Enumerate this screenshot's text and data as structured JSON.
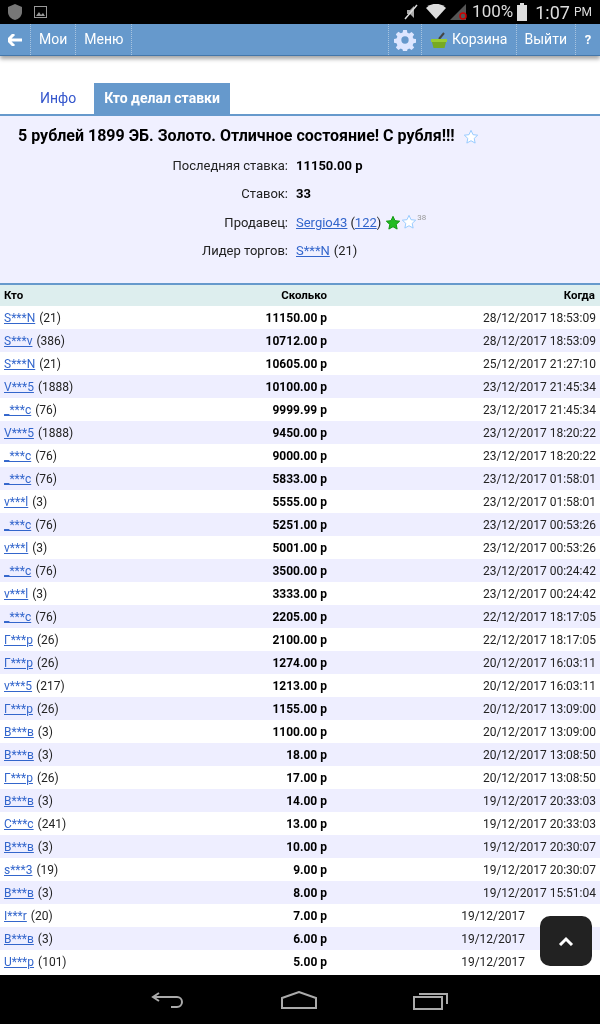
{
  "status_bar": {
    "battery": "100%",
    "time": "1:07",
    "ampm": "PM"
  },
  "nav": {
    "left": [
      "Мои",
      "Меню"
    ],
    "cart": "Корзина",
    "logout": "Выйти",
    "help": "?"
  },
  "tabs": [
    {
      "label": "Инфо",
      "selected": false
    },
    {
      "label": "Кто делал ставки",
      "selected": true
    }
  ],
  "lot": {
    "title": "5 рублей 1899 ЭБ. Золото. Отличное состояние! С рубля!!!",
    "fields": [
      {
        "kind": "bold",
        "label": "Последняя ставка:",
        "value": "11150.00 р"
      },
      {
        "kind": "bold",
        "label": "Ставок:",
        "value": "33"
      },
      {
        "kind": "seller",
        "label": "Продавец:",
        "name": "Sergio43",
        "open": "(",
        "rating": "122",
        "close": ")",
        "badge": "38"
      },
      {
        "kind": "user",
        "label": "Лидер торгов:",
        "name": "S***N",
        "count": "(21)"
      }
    ]
  },
  "table": {
    "columns": [
      "Кто",
      "Сколько",
      "Когда"
    ],
    "rows": [
      {
        "user": "S***N",
        "count": "(21)",
        "amount": "11150.00 р",
        "time": "28/12/2017 18:53:09"
      },
      {
        "user": "S***v",
        "count": "(386)",
        "amount": "10712.00 р",
        "time": "28/12/2017 18:53:09"
      },
      {
        "user": "S***N",
        "count": "(21)",
        "amount": "10605.00 р",
        "time": "25/12/2017 21:27:10"
      },
      {
        "user": "V***5",
        "count": "(1888)",
        "amount": "10100.00 р",
        "time": "23/12/2017 21:45:34"
      },
      {
        "user": "_***c",
        "count": "(76)",
        "amount": "9999.99 р",
        "time": "23/12/2017 21:45:34"
      },
      {
        "user": "V***5",
        "count": "(1888)",
        "amount": "9450.00 р",
        "time": "23/12/2017 18:20:22"
      },
      {
        "user": "_***c",
        "count": "(76)",
        "amount": "9000.00 р",
        "time": "23/12/2017 18:20:22"
      },
      {
        "user": "_***c",
        "count": "(76)",
        "amount": "5833.00 р",
        "time": "23/12/2017 01:58:01"
      },
      {
        "user": "v***l",
        "count": "(3)",
        "amount": "5555.00 р",
        "time": "23/12/2017 01:58:01"
      },
      {
        "user": "_***c",
        "count": "(76)",
        "amount": "5251.00 р",
        "time": "23/12/2017 00:53:26"
      },
      {
        "user": "v***l",
        "count": "(3)",
        "amount": "5001.00 р",
        "time": "23/12/2017 00:53:26"
      },
      {
        "user": "_***c",
        "count": "(76)",
        "amount": "3500.00 р",
        "time": "23/12/2017 00:24:42"
      },
      {
        "user": "v***l",
        "count": "(3)",
        "amount": "3333.00 р",
        "time": "23/12/2017 00:24:42"
      },
      {
        "user": "_***c",
        "count": "(76)",
        "amount": "2205.00 р",
        "time": "22/12/2017 18:17:05"
      },
      {
        "user": "Г***р",
        "count": "(26)",
        "amount": "2100.00 р",
        "time": "22/12/2017 18:17:05"
      },
      {
        "user": "Г***р",
        "count": "(26)",
        "amount": "1274.00 р",
        "time": "20/12/2017 16:03:11"
      },
      {
        "user": "v***5",
        "count": "(217)",
        "amount": "1213.00 р",
        "time": "20/12/2017 16:03:11"
      },
      {
        "user": "Г***р",
        "count": "(26)",
        "amount": "1155.00 р",
        "time": "20/12/2017 13:09:00"
      },
      {
        "user": "В***в",
        "count": "(3)",
        "amount": "1100.00 р",
        "time": "20/12/2017 13:09:00"
      },
      {
        "user": "В***в",
        "count": "(3)",
        "amount": "18.00 р",
        "time": "20/12/2017 13:08:50"
      },
      {
        "user": "Г***р",
        "count": "(26)",
        "amount": "17.00 р",
        "time": "20/12/2017 13:08:50"
      },
      {
        "user": "В***в",
        "count": "(3)",
        "amount": "14.00 р",
        "time": "19/12/2017 20:33:03"
      },
      {
        "user": "С***с",
        "count": "(241)",
        "amount": "13.00 р",
        "time": "19/12/2017 20:33:03"
      },
      {
        "user": "В***в",
        "count": "(3)",
        "amount": "10.00 р",
        "time": "19/12/2017 20:30:07"
      },
      {
        "user": "s***3",
        "count": "(19)",
        "amount": "9.00 р",
        "time": "19/12/2017 20:30:07"
      },
      {
        "user": "В***в",
        "count": "(3)",
        "amount": "8.00 р",
        "time": "19/12/2017 15:51:04"
      },
      {
        "user": "I***r",
        "count": "(20)",
        "amount": "7.00 р",
        "time": "19/12/2017"
      },
      {
        "user": "В***в",
        "count": "(3)",
        "amount": "6.00 р",
        "time": "19/12/2017"
      },
      {
        "user": "U***p",
        "count": "(101)",
        "amount": "5.00 р",
        "time": "19/12/2017"
      }
    ]
  }
}
